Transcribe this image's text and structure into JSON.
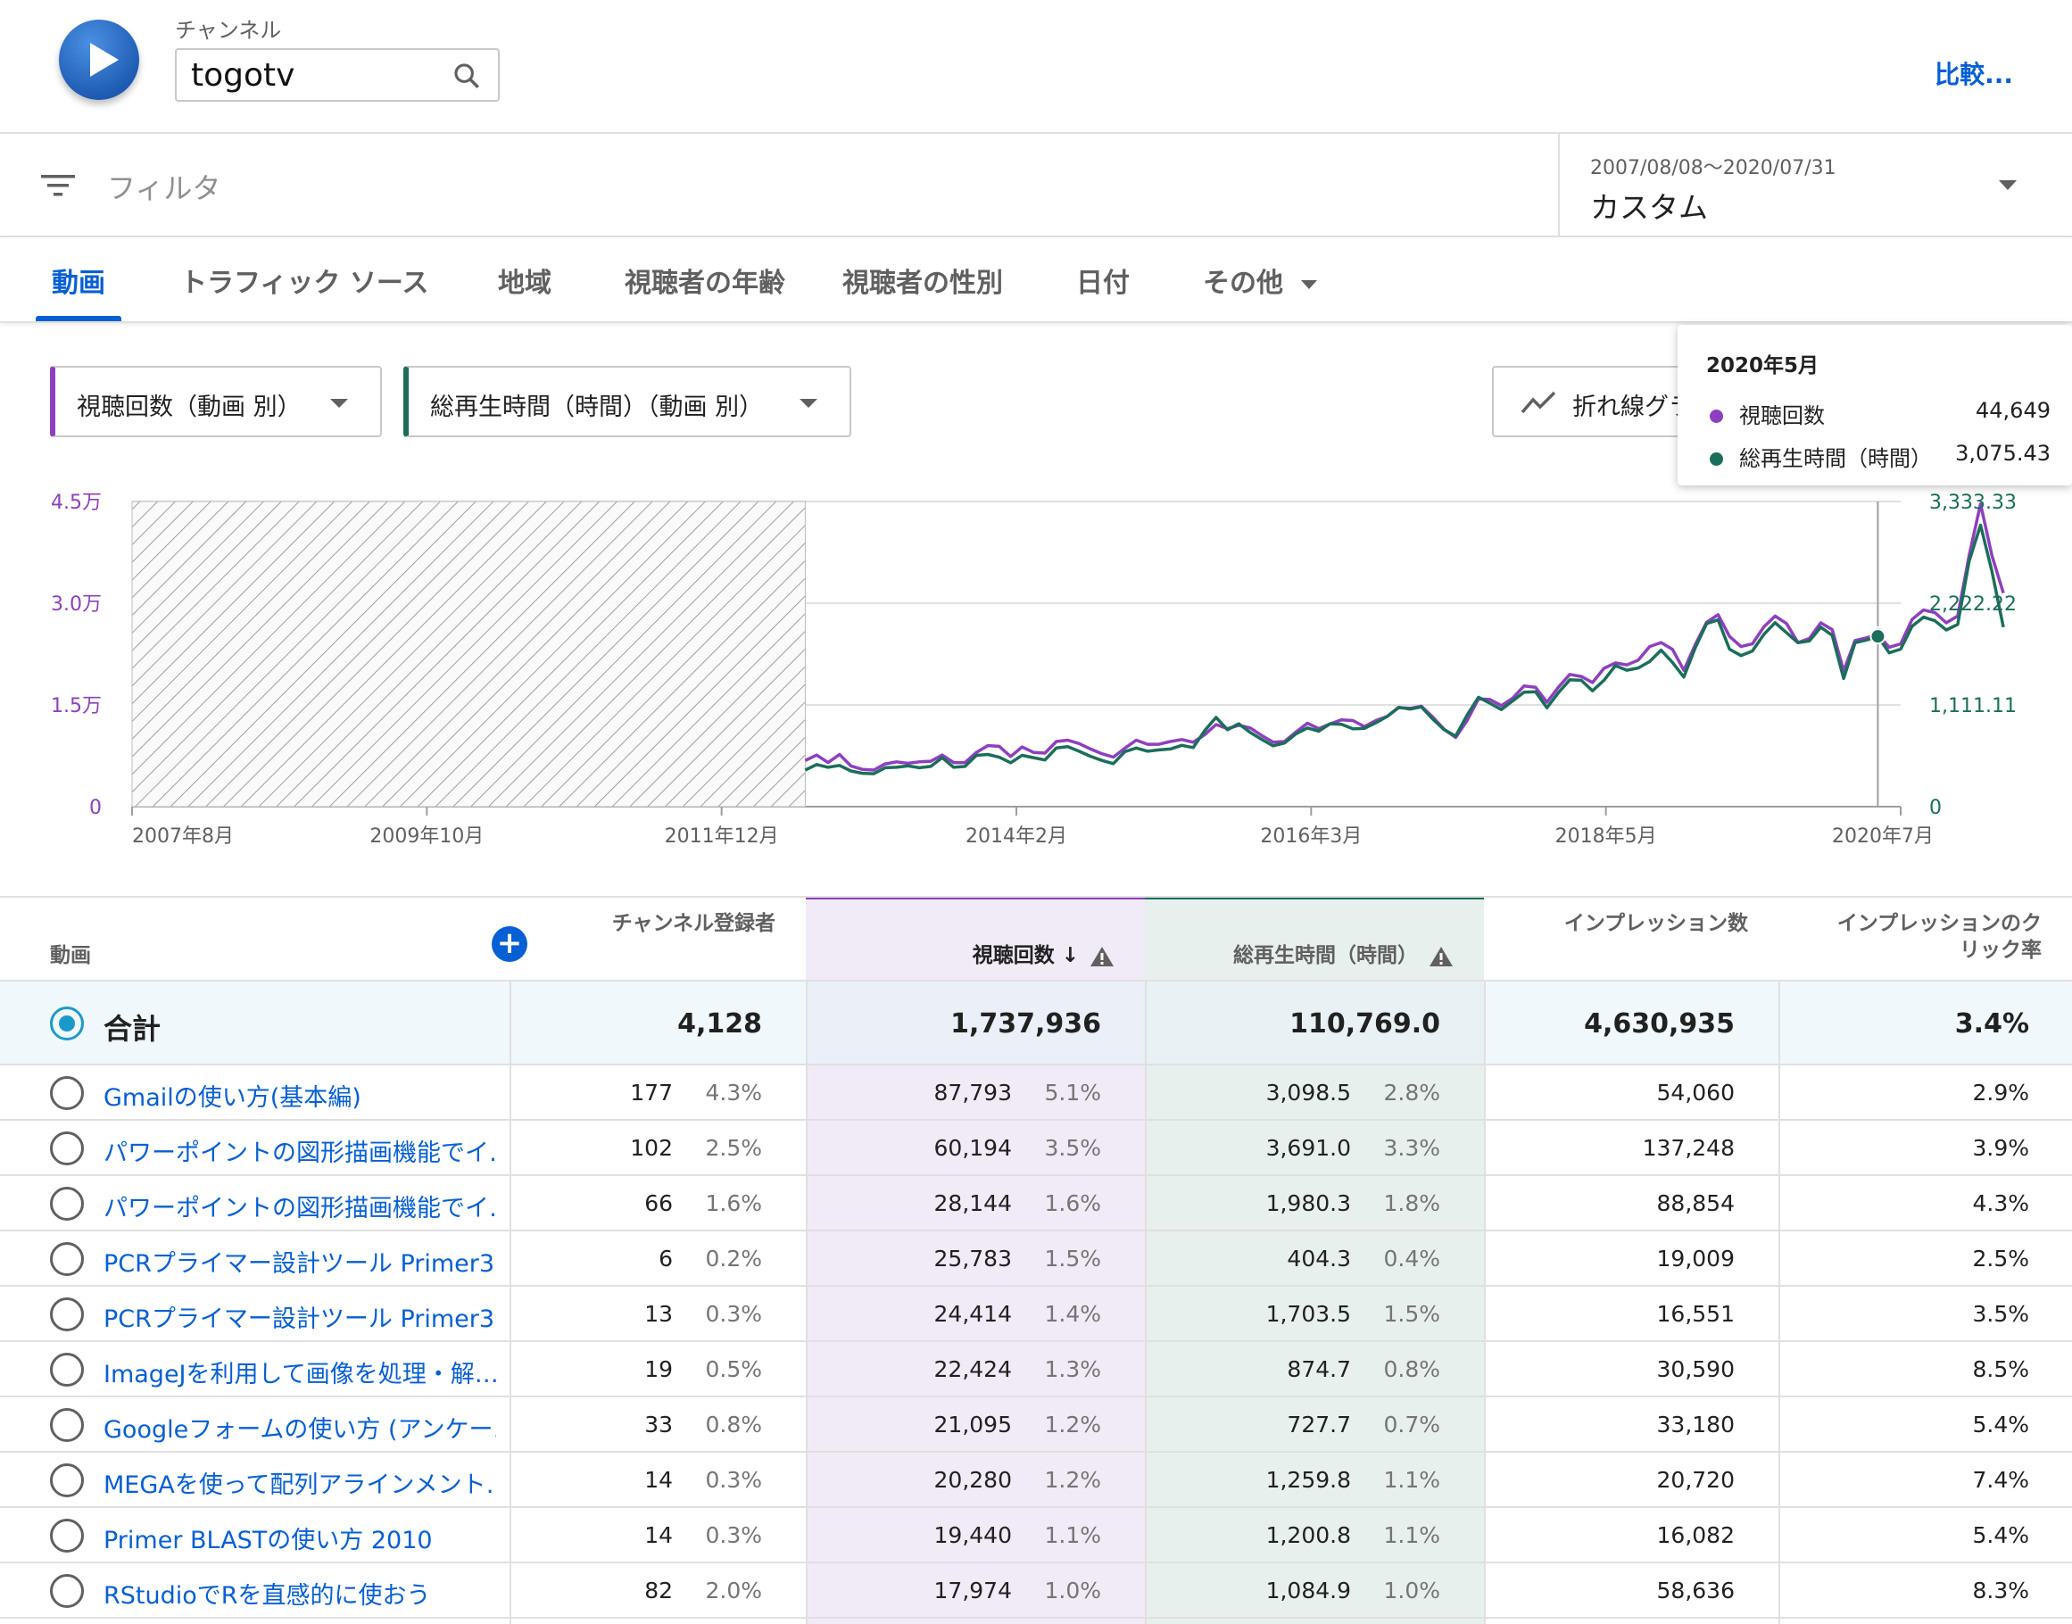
{
  "header": {
    "channel_label": "チャンネル",
    "search_value": "togotv",
    "compare_label": "比較..."
  },
  "filter": {
    "placeholder": "フィルタ",
    "date_range": "2007/08/08〜2020/07/31",
    "date_preset": "カスタム"
  },
  "tabs": [
    {
      "label": "動画",
      "active": true
    },
    {
      "label": "トラフィック ソース"
    },
    {
      "label": "地域"
    },
    {
      "label": "視聴者の年齢"
    },
    {
      "label": "視聴者の性別"
    },
    {
      "label": "日付"
    },
    {
      "label": "その他"
    }
  ],
  "metric_dropdowns": {
    "primary": "視聴回数（動画 別）",
    "secondary": "総再生時間（時間）（動画 別）",
    "chart_type": "折れ線グラフ"
  },
  "tooltip": {
    "title": "2020年5月",
    "rows": [
      {
        "label": "視聴回数",
        "value": "44,649",
        "color": "#8e3fbf"
      },
      {
        "label": "総再生時間（時間）",
        "value": "3,075.43",
        "color": "#1b6e5a"
      }
    ]
  },
  "chart_data": {
    "type": "line",
    "x_tick_labels": [
      "2007年8月",
      "2009年10月",
      "2011年12月",
      "2014年2月",
      "2016年3月",
      "2018年5月",
      "2020年7月"
    ],
    "y_left_ticks": [
      "0",
      "1.5万",
      "3.0万",
      "4.5万"
    ],
    "y_left_range": [
      0,
      45000
    ],
    "y_right_ticks": [
      "0",
      "1,111.11",
      "2,222.22",
      "3,333.33"
    ],
    "y_right_range": [
      0,
      3333.33
    ],
    "no_data_before": "2012-07",
    "series": [
      {
        "name": "視聴回数",
        "color": "#8e3fbf",
        "start": "2012-07",
        "values": [
          6800,
          7600,
          6500,
          7700,
          6000,
          5500,
          5400,
          6300,
          6600,
          6400,
          6600,
          6700,
          7600,
          6500,
          6500,
          8000,
          9000,
          8900,
          7400,
          8800,
          8000,
          7900,
          9600,
          9800,
          9300,
          8500,
          7800,
          7300,
          8600,
          9800,
          9200,
          9200,
          9600,
          9900,
          9500,
          10600,
          12100,
          11500,
          12000,
          11600,
          10500,
          9500,
          9600,
          11000,
          12300,
          11500,
          12200,
          12800,
          12700,
          11800,
          12700,
          13300,
          14600,
          14500,
          14800,
          13200,
          11400,
          10200,
          12700,
          15900,
          15800,
          14900,
          16000,
          17800,
          17600,
          15400,
          17600,
          19500,
          19200,
          18300,
          20400,
          21200,
          20900,
          21600,
          23600,
          24200,
          23200,
          20100,
          23900,
          27200,
          28300,
          25100,
          23600,
          24000,
          26500,
          28100,
          27000,
          24200,
          24800,
          27100,
          26100,
          20000,
          24500,
          24900,
          25400,
          23500,
          24000,
          27600,
          29000,
          28600,
          27100,
          28100,
          37000,
          44649,
          37000,
          31500
        ]
      },
      {
        "name": "総再生時間（時間）",
        "color": "#1b6e5a",
        "start": "2012-07",
        "values": [
          400,
          460,
          430,
          450,
          390,
          365,
          360,
          425,
          430,
          445,
          425,
          440,
          535,
          430,
          440,
          560,
          570,
          540,
          480,
          560,
          535,
          510,
          640,
          655,
          605,
          550,
          505,
          470,
          600,
          640,
          605,
          620,
          630,
          670,
          645,
          830,
          975,
          840,
          905,
          810,
          735,
          665,
          695,
          795,
          860,
          825,
          905,
          900,
          850,
          855,
          915,
          985,
          1085,
          1065,
          1090,
          955,
          840,
          770,
          1000,
          1195,
          1130,
          1060,
          1155,
          1250,
          1255,
          1080,
          1245,
          1385,
          1380,
          1265,
          1380,
          1540,
          1490,
          1515,
          1585,
          1710,
          1575,
          1415,
          1735,
          2000,
          2040,
          1720,
          1650,
          1700,
          1880,
          2010,
          1900,
          1790,
          1810,
          1960,
          1870,
          1400,
          1790,
          1820,
          1860,
          1680,
          1720,
          1970,
          2070,
          2030,
          1930,
          1990,
          2680,
          3075.43,
          2570,
          1960
        ]
      }
    ]
  },
  "table": {
    "add_column_label": "+",
    "headers": {
      "video": "動画",
      "subs": "チャンネル登録者",
      "views": "視聴回数",
      "watch": "総再生時間（時間）",
      "impr": "インプレッション数",
      "ctr": "インプレッションのクリック率"
    },
    "total": {
      "label": "合計",
      "subs": "4,128",
      "views": "1,737,936",
      "watch": "110,769.0",
      "impr": "4,630,935",
      "ctr": "3.4%"
    },
    "rows": [
      {
        "title": "Gmailの使い方(基本編)",
        "subs": "177",
        "subs_pct": "4.3%",
        "views": "87,793",
        "views_pct": "5.1%",
        "watch": "3,098.5",
        "watch_pct": "2.8%",
        "impr": "54,060",
        "ctr": "2.9%"
      },
      {
        "title": "パワーポイントの図形描画機能でイ…",
        "subs": "102",
        "subs_pct": "2.5%",
        "views": "60,194",
        "views_pct": "3.5%",
        "watch": "3,691.0",
        "watch_pct": "3.3%",
        "impr": "137,248",
        "ctr": "3.9%"
      },
      {
        "title": "パワーポイントの図形描画機能でイ…",
        "subs": "66",
        "subs_pct": "1.6%",
        "views": "28,144",
        "views_pct": "1.6%",
        "watch": "1,980.3",
        "watch_pct": "1.8%",
        "impr": "88,854",
        "ctr": "4.3%"
      },
      {
        "title": "PCRプライマー設計ツール Primer3…",
        "subs": "6",
        "subs_pct": "0.2%",
        "views": "25,783",
        "views_pct": "1.5%",
        "watch": "404.3",
        "watch_pct": "0.4%",
        "impr": "19,009",
        "ctr": "2.5%"
      },
      {
        "title": "PCRプライマー設計ツール Primer3…",
        "subs": "13",
        "subs_pct": "0.3%",
        "views": "24,414",
        "views_pct": "1.4%",
        "watch": "1,703.5",
        "watch_pct": "1.5%",
        "impr": "16,551",
        "ctr": "3.5%"
      },
      {
        "title": "ImageJを利用して画像を処理・解…",
        "subs": "19",
        "subs_pct": "0.5%",
        "views": "22,424",
        "views_pct": "1.3%",
        "watch": "874.7",
        "watch_pct": "0.8%",
        "impr": "30,590",
        "ctr": "8.5%"
      },
      {
        "title": "Googleフォームの使い方 (アンケー…",
        "subs": "33",
        "subs_pct": "0.8%",
        "views": "21,095",
        "views_pct": "1.2%",
        "watch": "727.7",
        "watch_pct": "0.7%",
        "impr": "33,180",
        "ctr": "5.4%"
      },
      {
        "title": "MEGAを使って配列アラインメント…",
        "subs": "14",
        "subs_pct": "0.3%",
        "views": "20,280",
        "views_pct": "1.2%",
        "watch": "1,259.8",
        "watch_pct": "1.1%",
        "impr": "20,720",
        "ctr": "7.4%"
      },
      {
        "title": "Primer BLASTの使い方 2010",
        "subs": "14",
        "subs_pct": "0.3%",
        "views": "19,440",
        "views_pct": "1.1%",
        "watch": "1,200.8",
        "watch_pct": "1.1%",
        "impr": "16,082",
        "ctr": "5.4%"
      },
      {
        "title": "RStudioでRを直感的に使おう",
        "subs": "82",
        "subs_pct": "2.0%",
        "views": "17,974",
        "views_pct": "1.0%",
        "watch": "1,084.9",
        "watch_pct": "1.0%",
        "impr": "58,636",
        "ctr": "8.3%"
      }
    ]
  }
}
